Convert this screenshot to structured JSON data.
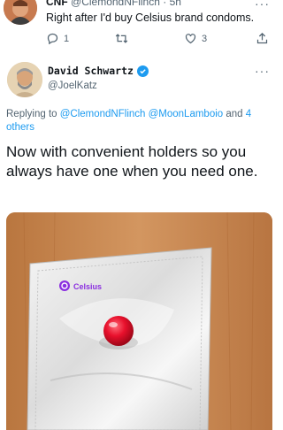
{
  "parent_tweet": {
    "name": "CNF",
    "handle": "@ClemondNFlinch",
    "separator": "·",
    "time": "5h",
    "text": "Right after I'd buy Celsius brand condoms.",
    "actions": {
      "reply_count": "1",
      "retweet_count": "",
      "like_count": "3"
    }
  },
  "tweet": {
    "author_name": "David Schwartz",
    "author_handle": "@JoelKatz",
    "replying_prefix": "Replying to ",
    "replying_users": "@ClemondNFlinch @MoonLamboio",
    "replying_connector": " and ",
    "replying_others": "4 others",
    "text": "Now with convenient holders so you always have one when you need one.",
    "image_brand": "Celsius"
  },
  "colors": {
    "accent": "#1d9bf0",
    "secondary_text": "#536471",
    "brand_purple": "#8b2fe0",
    "red_token": "#e8102c"
  },
  "icons": [
    "reply-icon",
    "retweet-icon",
    "like-icon",
    "share-icon",
    "more-icon",
    "verified-badge-icon"
  ]
}
